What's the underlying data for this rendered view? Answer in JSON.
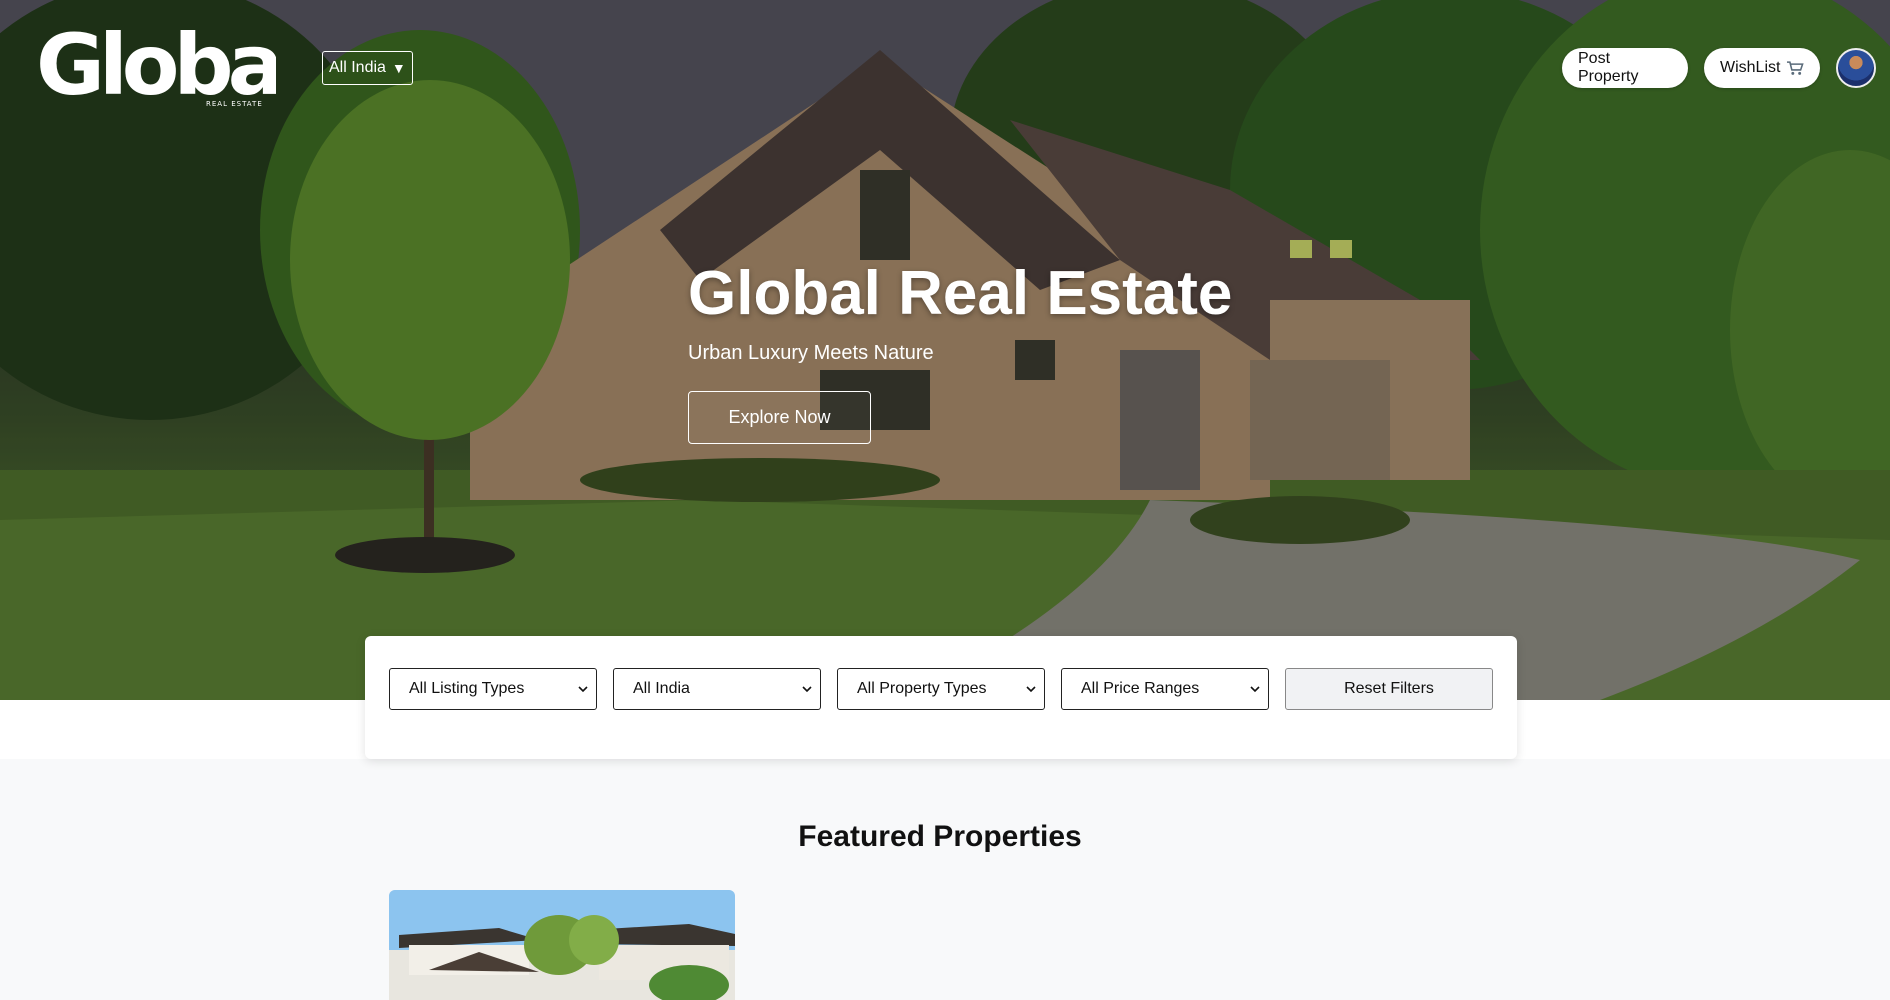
{
  "header": {
    "logo_text": "Global",
    "logo_subtext": "REAL ESTATE",
    "region": "All India",
    "post_property": "Post Property",
    "wishlist": "WishList",
    "wishlist_icon": "cart-icon"
  },
  "hero": {
    "title": "Global Real Estate",
    "subtitle": "Urban Luxury Meets Nature",
    "cta": "Explore Now"
  },
  "filters": {
    "listing_type": "All Listing Types",
    "location": "All India",
    "property_type": "All Property Types",
    "price_range": "All Price Ranges",
    "reset": "Reset Filters"
  },
  "featured": {
    "title": "Featured Properties"
  },
  "colors": {
    "page_bg": "#f8f9fa",
    "white": "#ffffff",
    "text": "#111111"
  }
}
